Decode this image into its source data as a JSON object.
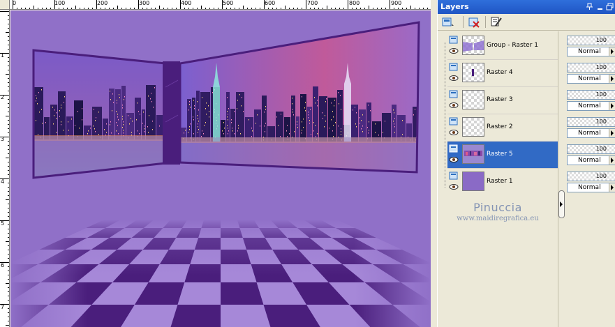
{
  "palette": {
    "title": "Layers",
    "title_buttons": [
      "pin-icon",
      "minimize-icon",
      "restore-icon"
    ],
    "toolbar": [
      "new-layer-icon",
      "delete-layer-icon",
      "layer-properties-icon"
    ]
  },
  "rulers": {
    "top": [
      "0",
      "100",
      "200",
      "300",
      "400",
      "500",
      "600",
      "700",
      "800",
      "900"
    ],
    "left": [
      "1",
      "2",
      "3",
      "4",
      "5",
      "6",
      "7"
    ]
  },
  "layers": [
    {
      "name": "Group - Raster 1",
      "opacity": "100",
      "blend": "Normal",
      "thumb": "group",
      "selected": false
    },
    {
      "name": "Raster 4",
      "opacity": "100",
      "blend": "Normal",
      "thumb": "bar",
      "selected": false
    },
    {
      "name": "Raster 3",
      "opacity": "100",
      "blend": "Normal",
      "thumb": "empty",
      "selected": false
    },
    {
      "name": "Raster 2",
      "opacity": "100",
      "blend": "Normal",
      "thumb": "empty",
      "selected": false
    },
    {
      "name": "Raster 5",
      "opacity": "100",
      "blend": "Normal",
      "thumb": "city",
      "selected": true
    },
    {
      "name": "Raster 1",
      "opacity": "100",
      "blend": "Normal",
      "thumb": "solid",
      "selected": false
    }
  ],
  "watermark": {
    "name": "Pinuccia",
    "url": "www.maidiregrafica.eu"
  },
  "colors": {
    "canvas_bg": "#9070c8",
    "dark_purple": "#4a1e7c",
    "light_purple": "#a688d8",
    "selection": "#316ac5",
    "title_bar": "#2459c8"
  }
}
